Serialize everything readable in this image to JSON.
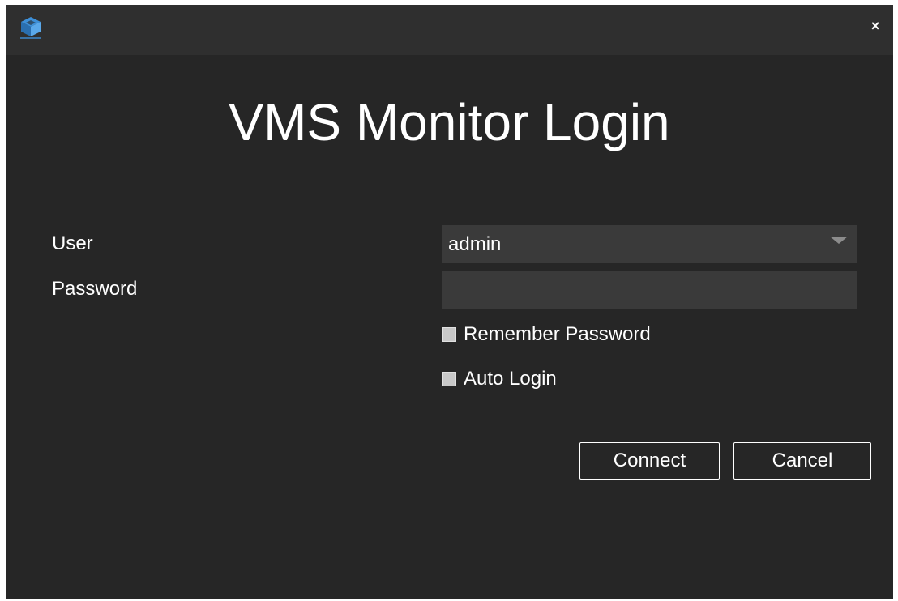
{
  "window": {
    "logo_icon": "heropspeed-cube-logo-icon",
    "close_label": "×"
  },
  "title": "VMS Monitor Login",
  "form": {
    "user_label": "User",
    "user_value": "admin",
    "password_label": "Password",
    "password_value": "",
    "remember_password_label": "Remember Password",
    "remember_password_checked": false,
    "auto_login_label": "Auto Login",
    "auto_login_checked": false
  },
  "buttons": {
    "connect_label": "Connect",
    "cancel_label": "Cancel"
  },
  "colors": {
    "window_bg": "#262626",
    "titlebar_bg": "#2f2f2f",
    "field_bg": "#3a3a3a",
    "text": "#ffffff",
    "logo_accent": "#3d8fd8"
  }
}
